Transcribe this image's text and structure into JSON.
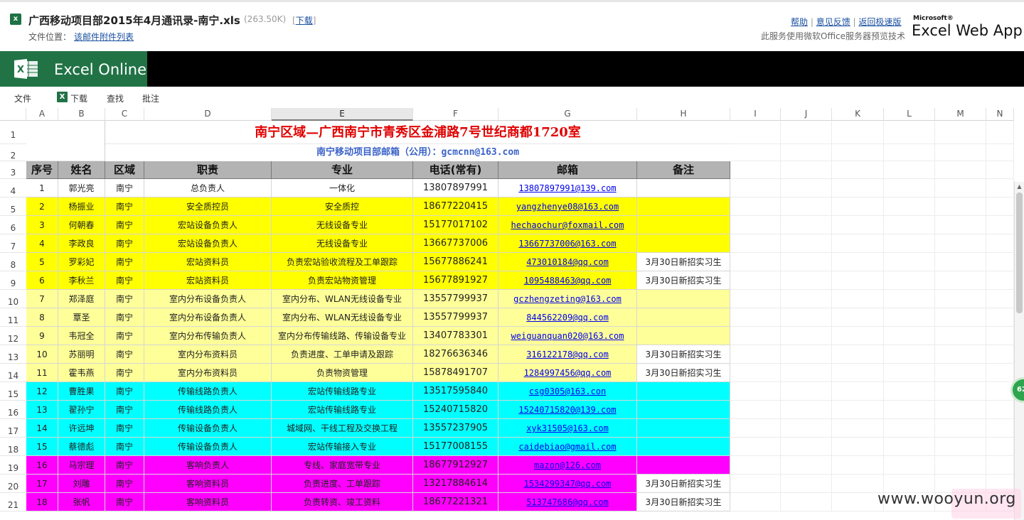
{
  "topbar": {
    "file_title": "广西移动项目部2015年4月通讯录-南宁.xls",
    "file_size": "(263.50K)",
    "download_prefix": "[",
    "download_label": "下载",
    "download_suffix": "]",
    "file_location_label": "文件位置：",
    "file_location_link": "该邮件附件列表",
    "links": [
      "帮助",
      "意见反馈",
      "返回极速版"
    ],
    "service_note": "此服务使用微软Office服务器预览技术",
    "brand_ms": "Microsoft®",
    "brand_app": "Excel Web App"
  },
  "banner": {
    "title": "Excel Online"
  },
  "ribbon": {
    "items": [
      "文件",
      "下载",
      "查找",
      "批注"
    ]
  },
  "columns": [
    "A",
    "B",
    "C",
    "D",
    "E",
    "F",
    "G",
    "H",
    "I",
    "J",
    "K",
    "L",
    "M",
    "N"
  ],
  "rows_visible": [
    "1",
    "2",
    "3",
    "4",
    "5",
    "6",
    "7",
    "8",
    "9",
    "10",
    "11",
    "12",
    "13",
    "14",
    "15",
    "16",
    "17",
    "18",
    "19",
    "20",
    "21"
  ],
  "sheet": {
    "title": "南宁区域—广西南宁市青秀区金浦路7号世纪商都1720室",
    "mailbox": "南宁移动项目部邮箱（公用）：gcmcnn@163.com",
    "headers": [
      "序号",
      "姓名",
      "区域",
      "职责",
      "专业",
      "电话(常有)",
      "邮箱",
      "备注"
    ],
    "colors": {
      "white": "#ffffff",
      "yellow": "#ffff00",
      "lightyellow": "#ffff99",
      "cyan": "#00ffff",
      "magenta": "#ff00ff"
    },
    "rows": [
      {
        "no": "1",
        "name": "郭光亮",
        "area": "南宁",
        "duty": "总负责人",
        "major": "一体化",
        "phone": "13807897991",
        "email": "13807897991@139.com",
        "note": "",
        "color": "white"
      },
      {
        "no": "2",
        "name": "杨振业",
        "area": "南宁",
        "duty": "安全质控员",
        "major": "安全质控",
        "phone": "18677220415",
        "email": "yangzhenye08@163.com",
        "note": "",
        "color": "yellow"
      },
      {
        "no": "3",
        "name": "何朝春",
        "area": "南宁",
        "duty": "宏站设备负责人",
        "major": "无线设备专业",
        "phone": "15177017102",
        "email": "hechaochur@foxmail.com",
        "note": "",
        "color": "yellow"
      },
      {
        "no": "4",
        "name": "李政良",
        "area": "南宁",
        "duty": "宏站设备负责人",
        "major": "无线设备专业",
        "phone": "13667737006",
        "email": "13667737006@163.com ",
        "note": "",
        "color": "yellow"
      },
      {
        "no": "5",
        "name": "罗彩妃",
        "area": "南宁",
        "duty": "宏站资料员",
        "major": "负责宏站验收流程及工单跟踪",
        "phone": "15677886241",
        "email": "473010184@qq.com",
        "note": "3月30日新招实习生",
        "color": "yellow"
      },
      {
        "no": "6",
        "name": "李秋兰",
        "area": "南宁",
        "duty": "宏站资料员",
        "major": "负责宏站物资管理",
        "phone": "15677891927",
        "email": "1095488463@qq.com",
        "note": "3月30日新招实习生",
        "color": "yellow"
      },
      {
        "no": "7",
        "name": "郑泽庭",
        "area": "南宁",
        "duty": "室内分布设备负责人",
        "major": "室内分布、WLAN无线设备专业",
        "phone": "13557799937",
        "email": "gczhengzeting@163.com",
        "note": "",
        "color": "lightyellow"
      },
      {
        "no": "8",
        "name": "覃圣",
        "area": "南宁",
        "duty": "室内分布设备负责人",
        "major": "室内分布、WLAN无线设备专业",
        "phone": "13557799937",
        "email": "844562209@qq.com",
        "note": "",
        "color": "lightyellow"
      },
      {
        "no": "9",
        "name": "韦冠全",
        "area": "南宁",
        "duty": "室内分布传输负责人",
        "major": "室内分布传输线路、传输设备专业",
        "phone": "13407783301",
        "email": "weiguanquan020@163.com",
        "note": "",
        "color": "lightyellow"
      },
      {
        "no": "10",
        "name": "苏丽明",
        "area": "南宁",
        "duty": "室内分布资料员",
        "major": "负责进度、工单申请及跟踪",
        "phone": "18276636346",
        "email": "316122178@qq.com",
        "note": "3月30日新招实习生",
        "color": "lightyellow"
      },
      {
        "no": "11",
        "name": "霍韦燕",
        "area": "南宁",
        "duty": "室内分布资料员",
        "major": "负责物资管理",
        "phone": "15878491707",
        "email": "1284997456@qq.com",
        "note": "3月30日新招实习生",
        "color": "lightyellow"
      },
      {
        "no": "12",
        "name": "曹胜果",
        "area": "南宁",
        "duty": "传输线路负责人",
        "major": "宏站传输线路专业",
        "phone": "13517595840",
        "email": "csg0305@163.con",
        "note": "",
        "color": "cyan"
      },
      {
        "no": "13",
        "name": "翟孙宁",
        "area": "南宁",
        "duty": "传输线路负责人",
        "major": "宏站传输线路专业",
        "phone": "15240715820",
        "email": "15240715820@139.com",
        "note": "",
        "color": "cyan"
      },
      {
        "no": "14",
        "name": "许远坤",
        "area": "南宁",
        "duty": "传输设备负责人",
        "major": "城域网、干线工程及交换工程",
        "phone": "13557237905",
        "email": "xyk31505@163.com",
        "note": "",
        "color": "cyan"
      },
      {
        "no": "15",
        "name": "蔡德彪",
        "area": "南宁",
        "duty": "传输设备负责人",
        "major": "宏站传输接入专业",
        "phone": "15177008155",
        "email": "caidebiao@gmail.com",
        "note": "",
        "color": "cyan"
      },
      {
        "no": "16",
        "name": "马宗理",
        "area": "南宁",
        "duty": "客响负责人",
        "major": "专线、家庭宽带专业",
        "phone": "18677912927",
        "email": "mazon@126.com",
        "note": "",
        "color": "magenta"
      },
      {
        "no": "17",
        "name": "刘雕",
        "area": "南宁",
        "duty": "客响资料员",
        "major": "负责进度、工单跟踪",
        "phone": "13217884614",
        "email": "1534299347@qq.com",
        "note": "3月30日新招实习生",
        "color": "magenta"
      },
      {
        "no": "18",
        "name": "张帆",
        "area": "南宁",
        "duty": "客响资料员",
        "major": "负责转资、竣工资料",
        "phone": "18677221321",
        "email": "513747686@qq.com",
        "note": "3月30日新招实习生",
        "color": "magenta"
      }
    ]
  },
  "side_button": {
    "label": "62"
  },
  "watermark": {
    "text": "www.wooyun.org"
  }
}
